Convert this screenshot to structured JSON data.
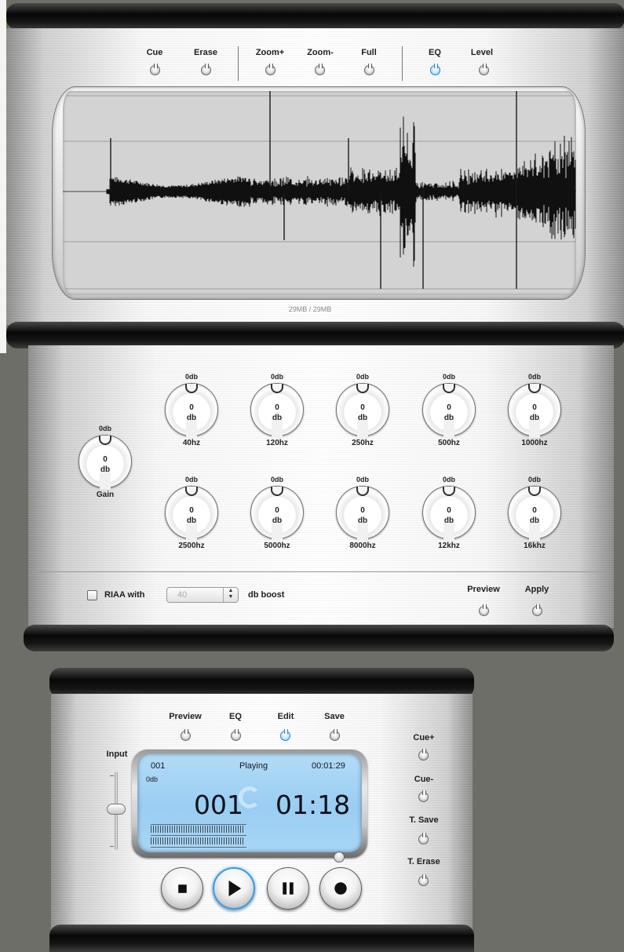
{
  "top_panel": {
    "buttons": [
      {
        "label": "Cue",
        "active": false
      },
      {
        "label": "Erase",
        "active": false
      },
      {
        "label": "Zoom+",
        "active": false
      },
      {
        "label": "Zoom-",
        "active": false
      },
      {
        "label": "Full",
        "active": false
      },
      {
        "label": "EQ",
        "active": true
      },
      {
        "label": "Level",
        "active": false
      }
    ],
    "waveform_size": "29MB / 29MB"
  },
  "eq_panel": {
    "gain": {
      "top": "0db",
      "value": "0",
      "unit": "db",
      "label": "Gain"
    },
    "bands": [
      {
        "top": "0db",
        "value": "0",
        "unit": "db",
        "label": "40hz"
      },
      {
        "top": "0db",
        "value": "0",
        "unit": "db",
        "label": "120hz"
      },
      {
        "top": "0db",
        "value": "0",
        "unit": "db",
        "label": "250hz"
      },
      {
        "top": "0db",
        "value": "0",
        "unit": "db",
        "label": "500hz"
      },
      {
        "top": "0db",
        "value": "0",
        "unit": "db",
        "label": "1000hz"
      },
      {
        "top": "0db",
        "value": "0",
        "unit": "db",
        "label": "2500hz"
      },
      {
        "top": "0db",
        "value": "0",
        "unit": "db",
        "label": "5000hz"
      },
      {
        "top": "0db",
        "value": "0",
        "unit": "db",
        "label": "8000hz"
      },
      {
        "top": "0db",
        "value": "0",
        "unit": "db",
        "label": "12khz"
      },
      {
        "top": "0db",
        "value": "0",
        "unit": "db",
        "label": "16khz"
      }
    ],
    "riaa_label": "RIAA with",
    "riaa_checked": false,
    "boost_value": "40",
    "boost_suffix": "db boost",
    "preview_label": "Preview",
    "apply_label": "Apply"
  },
  "player": {
    "buttons": [
      {
        "label": "Preview",
        "active": false
      },
      {
        "label": "EQ",
        "active": false
      },
      {
        "label": "Edit",
        "active": true
      },
      {
        "label": "Save",
        "active": false
      }
    ],
    "side_buttons": [
      {
        "label": "Cue+"
      },
      {
        "label": "Cue-"
      },
      {
        "label": "T. Save"
      },
      {
        "label": "T. Erase"
      }
    ],
    "input_label": "Input",
    "input_level": 0.5,
    "lcd": {
      "track": "001",
      "status": "Playing",
      "time_total": "00:01:29",
      "level": "0db",
      "big_track": "001",
      "big_time": "01:18",
      "meter_left": 0.98,
      "meter_right": 0.98
    },
    "transport": [
      "stop",
      "play",
      "pause",
      "record"
    ],
    "active_transport": "play"
  },
  "colors": {
    "accent": "#2c86d6",
    "lcd": "#a6d3f4",
    "background": "#6e6e68"
  }
}
